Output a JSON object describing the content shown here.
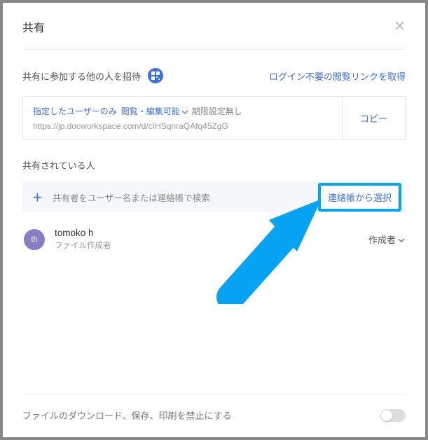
{
  "header": {
    "title": "共有"
  },
  "invite": {
    "label": "共有に参加する他の人を招待",
    "get_link_label": "ログイン不要の閲覧リンクを取得"
  },
  "link_box": {
    "setting_scope": "指定したユーザーのみ",
    "setting_perm": "閲覧・編集可能",
    "setting_expiry": "期限設定無し",
    "url": "https://jp.docworkspace.com/d/cIHSqnraQAfq45ZgG",
    "copy_label": "コピー"
  },
  "shared": {
    "heading": "共有されている人",
    "search_placeholder": "共有者をユーザー名または連絡帳で検索",
    "contacts_button": "連絡帳から選択"
  },
  "people": [
    {
      "avatar_initials": "th",
      "name": "tomoko h",
      "role_label": "ファイル作成者",
      "role_dropdown": "作成者"
    }
  ],
  "footer": {
    "disable_download_label": "ファイルのダウンロード、保存、印刷を禁止にする",
    "toggle_on": false
  }
}
